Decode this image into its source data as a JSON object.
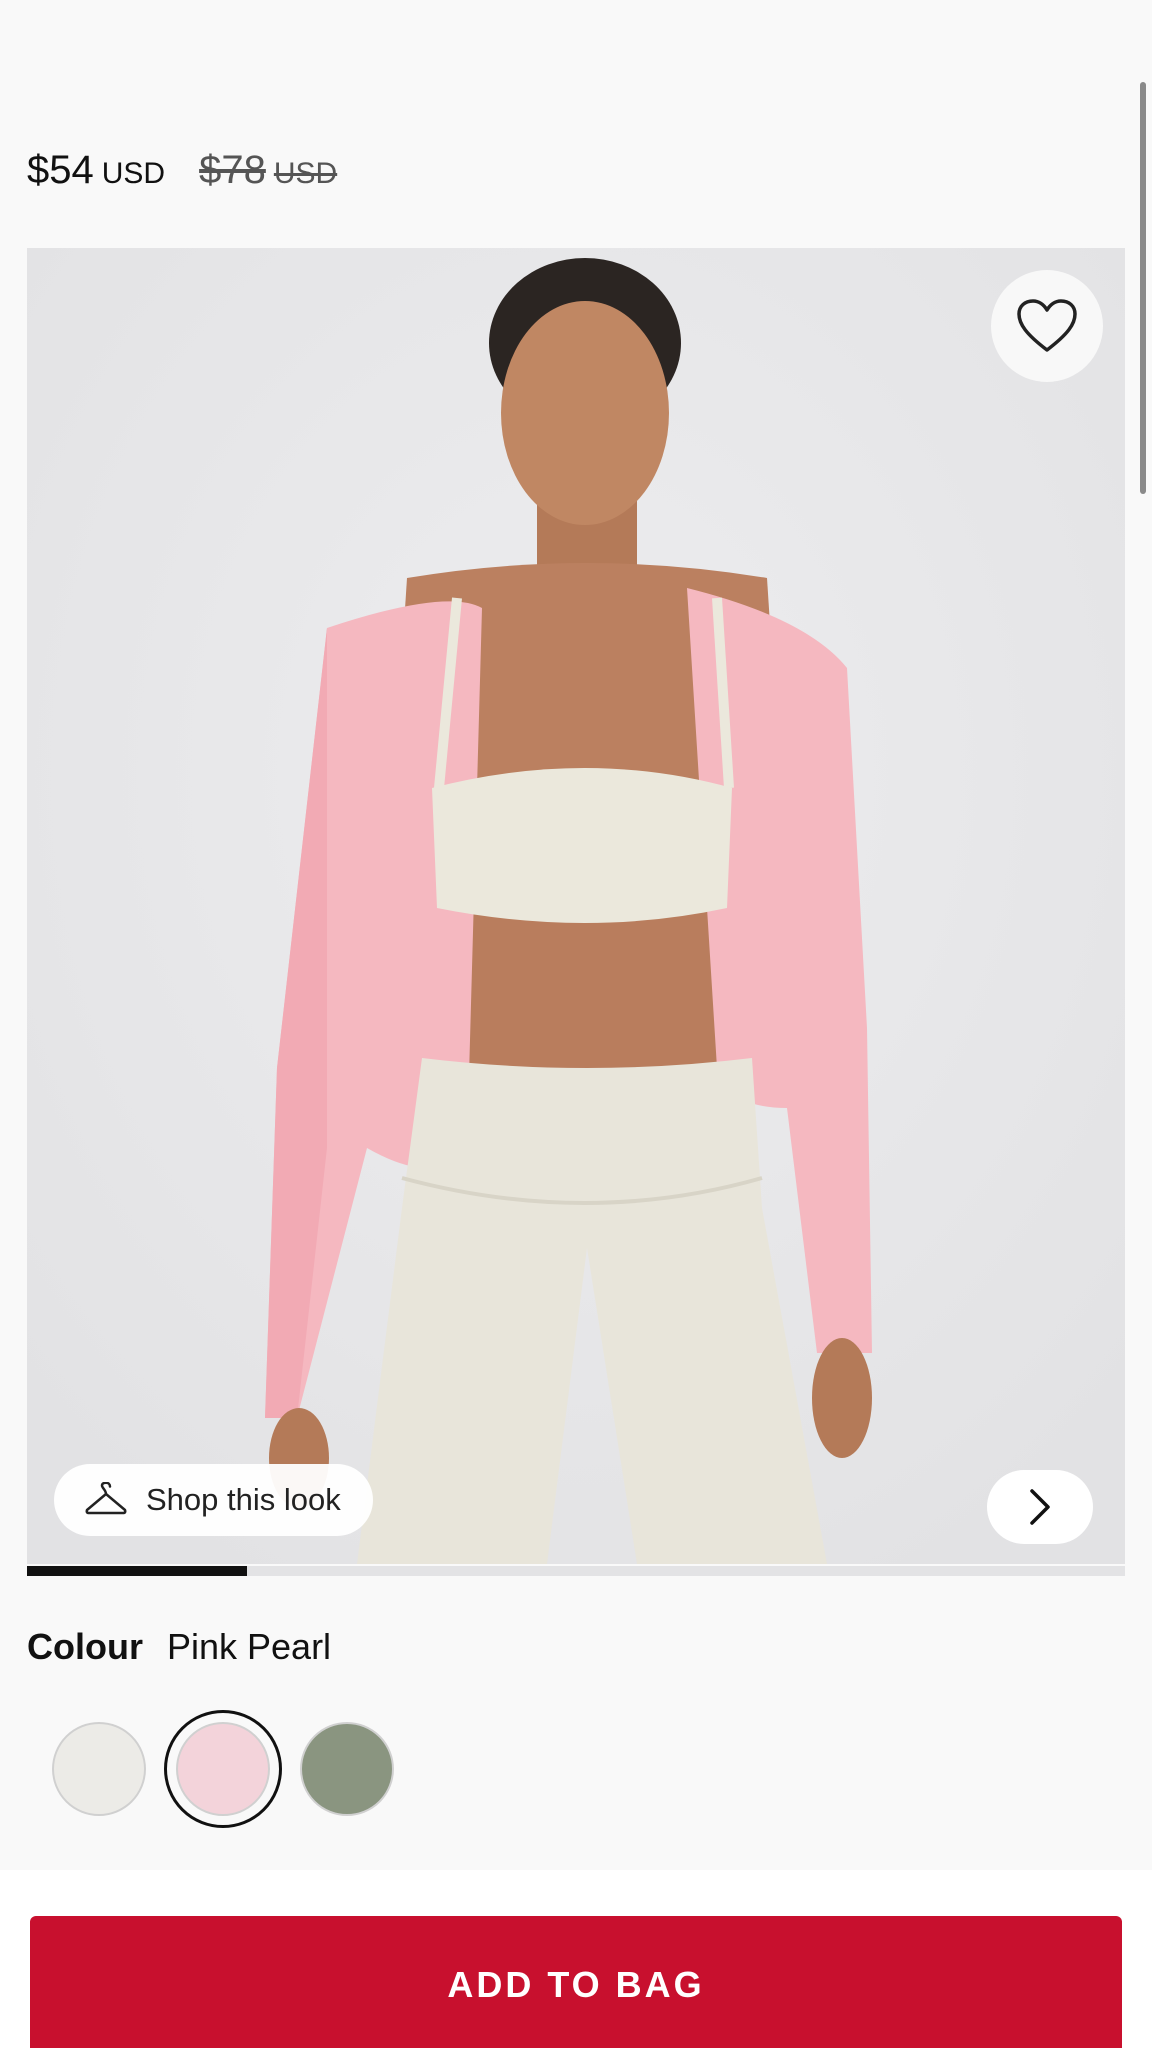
{
  "product": {
    "price_current": "$54",
    "price_current_currency": "USD",
    "price_original": "$78",
    "price_original_currency": "USD"
  },
  "gallery": {
    "shop_look_label": "Shop this look",
    "image_progress": 0.2
  },
  "colour": {
    "label": "Colour",
    "selected_name": "Pink Pearl",
    "swatches": [
      {
        "color": "#ecebe7",
        "selected": false
      },
      {
        "color": "#f3d3da",
        "selected": true
      },
      {
        "color": "#8a9580",
        "selected": false
      }
    ]
  },
  "actions": {
    "add_to_bag_label": "ADD TO BAG"
  },
  "colors": {
    "accent": "#c8102e"
  }
}
